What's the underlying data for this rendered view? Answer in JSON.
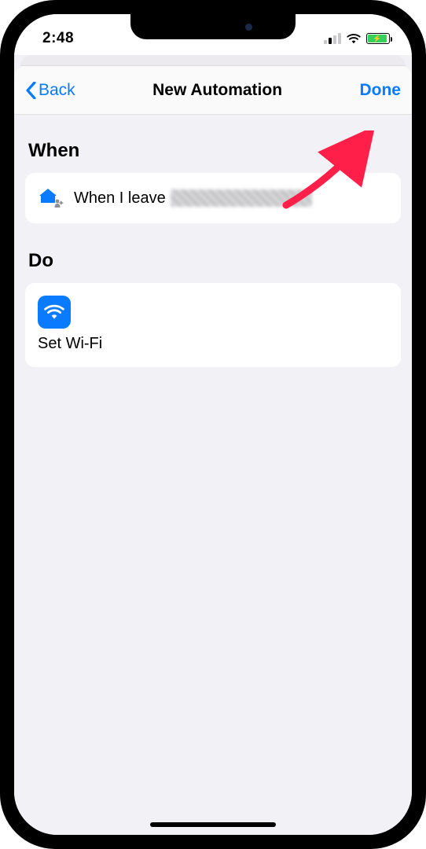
{
  "statusbar": {
    "time": "2:48"
  },
  "nav": {
    "back_label": "Back",
    "title": "New Automation",
    "done_label": "Done"
  },
  "sections": {
    "when_label": "When",
    "do_label": "Do"
  },
  "trigger": {
    "text_prefix": "When I leave"
  },
  "action": {
    "label": "Set Wi-Fi"
  },
  "colors": {
    "accent": "#0a7aff",
    "battery_fill": "#35d15a",
    "arrow": "#ff1f49"
  }
}
